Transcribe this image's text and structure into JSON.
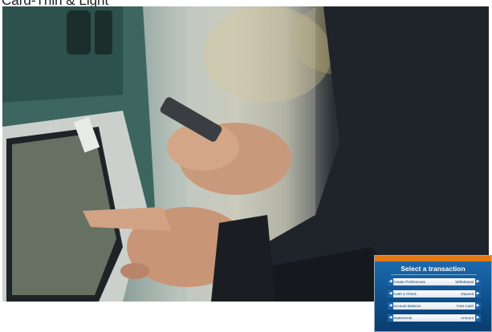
{
  "heading": "Card-Thin & Light",
  "atm_screen": {
    "title": "Select a transaction",
    "left_options": [
      "Create Preferences",
      "Cash a Check",
      "Account Balance",
      "Statements"
    ],
    "right_options": [
      "Withdrawal",
      "Deposit",
      "Fast Cash",
      "Amount"
    ],
    "accent_color": "#e37a16",
    "screen_color": "#0e4f8a"
  },
  "icons": {
    "left_arrow": "◀",
    "right_arrow": "▶"
  }
}
